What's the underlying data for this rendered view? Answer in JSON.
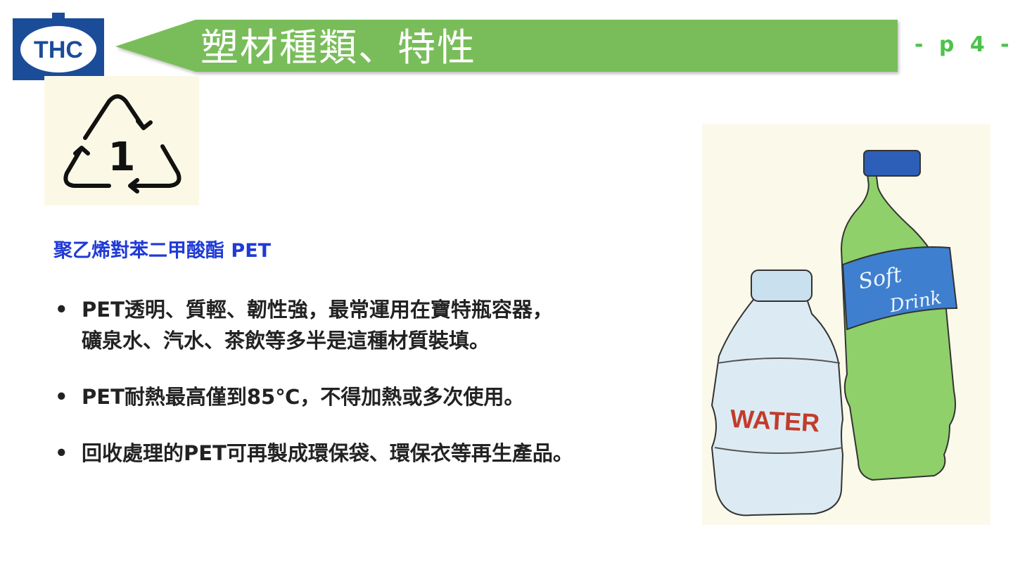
{
  "header": {
    "logo_text": "THC",
    "title": "塑材種類、特性",
    "page_number": "- p 4 -"
  },
  "colors": {
    "banner_green": "#79bd5a",
    "logo_blue": "#1b4c98",
    "subtitle_blue": "#1f3ad6",
    "page_number_green": "#4cc24c"
  },
  "recycle_symbol": {
    "code": "1",
    "icon": "recycle-triangle-icon"
  },
  "content": {
    "subtitle": "聚乙烯對苯二甲酸酯 PET",
    "bullets": [
      {
        "lines": [
          "PET透明、質輕、韌性強，最常運用在寶特瓶容器，",
          "礦泉水、汽水、茶飲等多半是這種材質裝填。"
        ]
      },
      {
        "lines": [
          "PET耐熱最高僅到85℃，不得加熱或多次使用。"
        ]
      },
      {
        "lines": [
          "回收處理的PET可再製成環保袋、環保衣等再生產品。"
        ]
      }
    ]
  },
  "illustration": {
    "soft_drink_label_1": "Soft",
    "soft_drink_label_2": "Drink",
    "water_label": "WATER"
  }
}
